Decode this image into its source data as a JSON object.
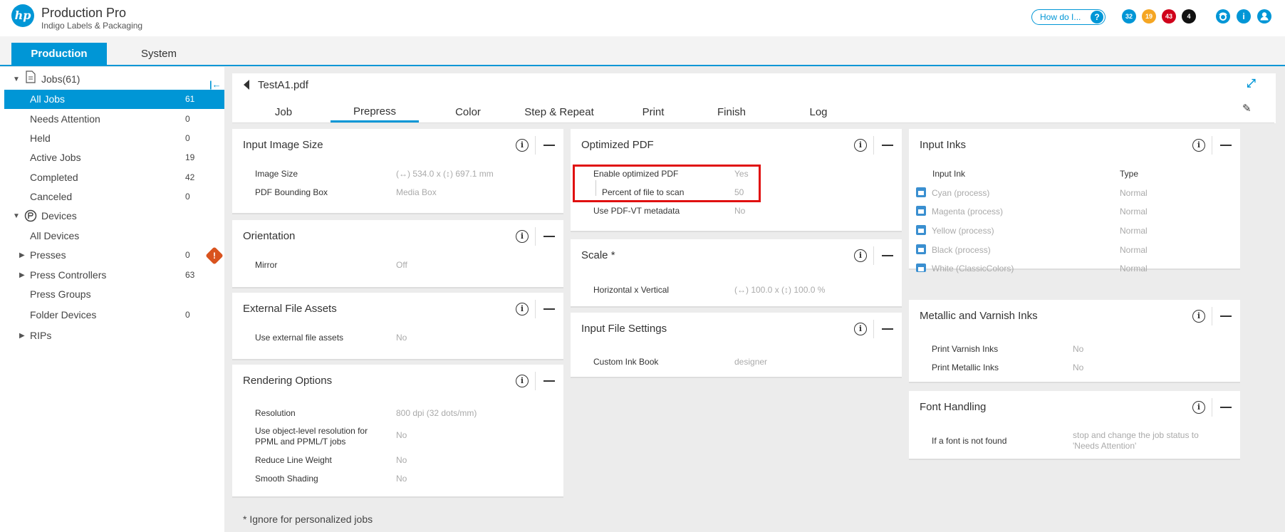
{
  "header": {
    "logo": "hp",
    "title": "Production Pro",
    "subtitle": "Indigo Labels & Packaging",
    "howdo": "How do I...",
    "howdo_icon": "?",
    "badges": [
      {
        "value": "32",
        "color": "#0096d6"
      },
      {
        "value": "19",
        "color": "#f5a623"
      },
      {
        "value": "43",
        "color": "#d0021b"
      },
      {
        "value": "4",
        "color": "#111111"
      }
    ],
    "icons": [
      "tool-icon",
      "info-icon",
      "user-icon"
    ],
    "info_glyph": "i"
  },
  "main_tabs": [
    {
      "label": "Production",
      "active": true
    },
    {
      "label": "System",
      "active": false
    }
  ],
  "sidebar": {
    "jobs_header": "Jobs(61)",
    "jobs": [
      {
        "label": "All Jobs",
        "count": "61",
        "active": true
      },
      {
        "label": "Needs Attention",
        "count": "0"
      },
      {
        "label": "Held",
        "count": "0"
      },
      {
        "label": "Active Jobs",
        "count": "19"
      },
      {
        "label": "Completed",
        "count": "42"
      },
      {
        "label": "Canceled",
        "count": "0"
      }
    ],
    "devices_header": "Devices",
    "devices": [
      {
        "label": "All Devices",
        "count": ""
      },
      {
        "label": "Presses",
        "count": "0",
        "expandable": true,
        "warning": true
      },
      {
        "label": "Press Controllers",
        "count": "63",
        "expandable": true
      },
      {
        "label": "Press Groups",
        "count": ""
      },
      {
        "label": "Folder Devices",
        "count": "0"
      },
      {
        "label": "RIPs",
        "count": "",
        "expandable": true
      }
    ],
    "warning_glyph": "!"
  },
  "job": {
    "filename": "TestA1.pdf",
    "tabs": [
      "Job",
      "Prepress",
      "Color",
      "Step & Repeat",
      "Print",
      "Finish",
      "Log"
    ],
    "active_tab": "Prepress"
  },
  "panels": {
    "input_image_size": {
      "title": "Input Image Size",
      "rows": [
        {
          "label": "Image Size",
          "value": "(↔) 534.0 x (↕) 697.1 mm"
        },
        {
          "label": "PDF Bounding Box",
          "value": "Media Box"
        }
      ]
    },
    "orientation": {
      "title": "Orientation",
      "rows": [
        {
          "label": "Mirror",
          "value": "Off"
        }
      ]
    },
    "external_file_assets": {
      "title": "External File Assets",
      "rows": [
        {
          "label": "Use external file assets",
          "value": "No"
        }
      ]
    },
    "rendering_options": {
      "title": "Rendering Options",
      "rows": [
        {
          "label": "Resolution",
          "value": "800 dpi (32 dots/mm)"
        },
        {
          "label": "Use object-level resolution for PPML and PPML/T jobs",
          "value": "No"
        },
        {
          "label": "Reduce Line Weight",
          "value": "No"
        },
        {
          "label": "Smooth Shading",
          "value": "No"
        }
      ]
    },
    "optimized_pdf": {
      "title": "Optimized PDF",
      "rows": [
        {
          "label": "Enable optimized PDF",
          "value": "Yes"
        },
        {
          "label": "Percent of file to scan",
          "value": "50"
        },
        {
          "label": "Use PDF-VT metadata",
          "value": "No"
        }
      ]
    },
    "scale": {
      "title": "Scale *",
      "rows": [
        {
          "label": "Horizontal x Vertical",
          "value": "(↔) 100.0 x (↕) 100.0 %"
        }
      ]
    },
    "input_file_settings": {
      "title": "Input File Settings",
      "rows": [
        {
          "label": "Custom Ink Book",
          "value": "designer"
        }
      ]
    },
    "input_inks": {
      "title": "Input Inks",
      "col_ink": "Input Ink",
      "col_type": "Type",
      "rows": [
        {
          "ink": "Cyan (process)",
          "type": "Normal"
        },
        {
          "ink": "Magenta (process)",
          "type": "Normal"
        },
        {
          "ink": "Yellow (process)",
          "type": "Normal"
        },
        {
          "ink": "Black (process)",
          "type": "Normal"
        },
        {
          "ink": "White (ClassicColors)",
          "type": "Normal"
        }
      ]
    },
    "metallic_varnish": {
      "title": "Metallic and Varnish Inks",
      "rows": [
        {
          "label": "Print Varnish Inks",
          "value": "No"
        },
        {
          "label": "Print Metallic Inks",
          "value": "No"
        }
      ]
    },
    "font_handling": {
      "title": "Font Handling",
      "rows": [
        {
          "label": "If a font is not found",
          "value": "stop and change the job status to 'Needs Attention'"
        }
      ]
    }
  },
  "footnote": "* Ignore for personalized jobs"
}
